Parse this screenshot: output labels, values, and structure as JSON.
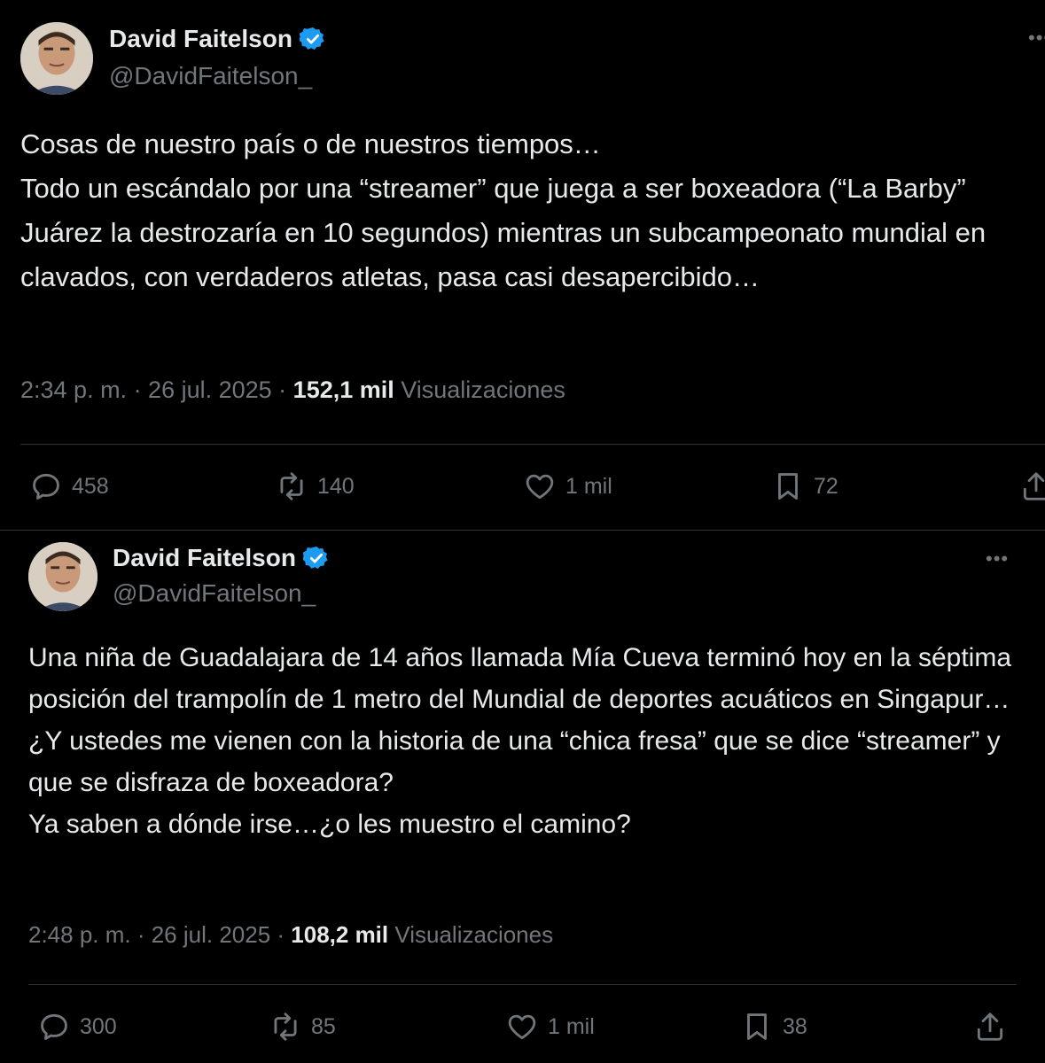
{
  "tweets": [
    {
      "name": "David Faitelson",
      "handle": "@DavidFaitelson_",
      "text": "Cosas de nuestro país o de nuestros tiempos…\nTodo un escándalo por una “streamer” que juega a ser boxeadora (“La Barby” Juárez la destrozaría en 10 segundos) mientras un subcampeonato mundial en clavados, con verdaderos atletas, pasa casi desapercibido…",
      "timestamp": "2:34 p. m. · 26 jul. 2025 · ",
      "views_count": "152,1 mil",
      "views_label": " Visualizaciones",
      "replies": "458",
      "reposts": "140",
      "likes": "1 mil",
      "bookmarks": "72"
    },
    {
      "name": "David Faitelson",
      "handle": "@DavidFaitelson_",
      "text": "Una niña de Guadalajara de 14 años llamada Mía Cueva terminó hoy en la séptima posición del trampolín de 1 metro del Mundial de deportes acuáticos en Singapur…\n¿Y ustedes me vienen con la historia de una “chica fresa” que se dice “streamer” y que se disfraza de boxeadora?\nYa saben a dónde irse…¿o les muestro el camino?",
      "timestamp": "2:48 p. m. · 26 jul. 2025 · ",
      "views_count": "108,2 mil",
      "views_label": " Visualizaciones",
      "replies": "300",
      "reposts": "85",
      "likes": "1 mil",
      "bookmarks": "38"
    }
  ],
  "icons": {
    "verified": "verified-badge-icon",
    "more": "more-options-icon",
    "reply": "reply-icon",
    "repost": "repost-icon",
    "like": "heart-icon",
    "bookmark": "bookmark-icon",
    "share": "share-icon"
  },
  "colors": {
    "background": "#000000",
    "text": "#e7e9ea",
    "muted": "#71767b",
    "verified": "#1d9bf0",
    "divider": "#2f3336"
  }
}
